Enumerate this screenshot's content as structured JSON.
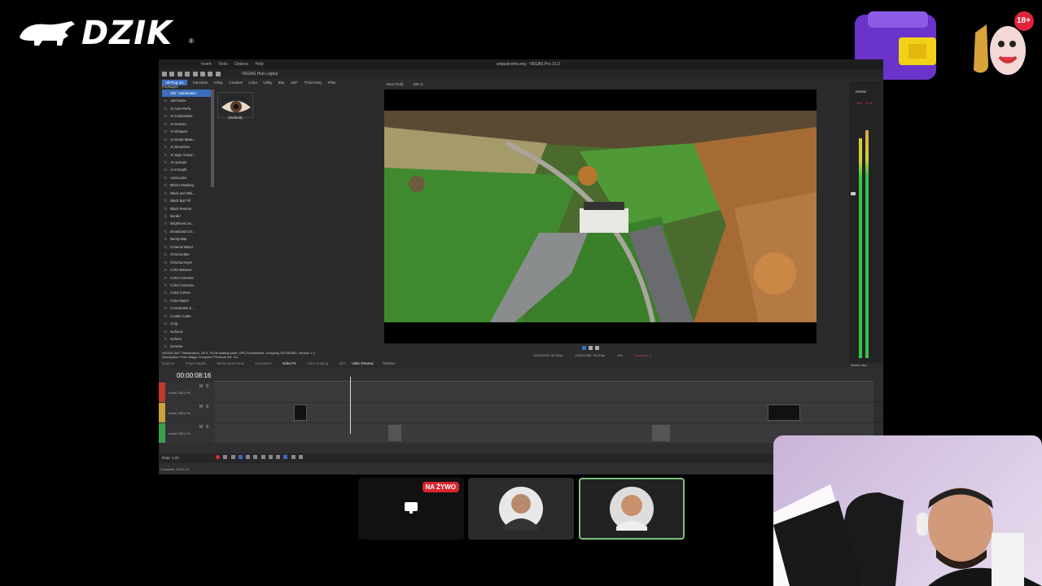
{
  "brand": {
    "logo_text": "DZIK",
    "reg_mark": "®"
  },
  "stickers": {
    "age_badge": "18+"
  },
  "app": {
    "menu": [
      "Insert",
      "Tools",
      "Options",
      "Help"
    ],
    "window_title": "wejazd-sms.veg - VEGAS Pro 21.0",
    "hub_label": "VEGAS Hub Logout",
    "fx_tabs": [
      "All Plug-ins",
      "Favorites",
      "AI/ML",
      "Creative",
      "Color",
      "Utility",
      "Blur",
      "360°",
      "Third Party",
      "Filter Packages"
    ],
    "fx_list": [
      "360° Stabilization",
      "Add Noise",
      "AI Auto-Perfe...",
      "AI Colorization",
      "AI Dehaze",
      "AI Sharpen",
      "AI Smart Mask...",
      "AI Smoothen",
      "AI Style Transf...",
      "AI Upscale",
      "AI Z-Depth",
      "AutoLooks",
      "Bézier Masking",
      "Black and Whi...",
      "Black Bar Fill",
      "Black Restore",
      "Border",
      "Brightness an...",
      "Broadcast Col...",
      "Bump Map",
      "Channel Blend",
      "Chroma Blur",
      "Chroma Keyer",
      "Color Balance",
      "Color Corrector",
      "Color Correctio...",
      "Color Curves",
      "Color Match",
      "Convolution K...",
      "Cookie Cutter",
      "Crop",
      "Defocus",
      "Deform",
      "Denoise"
    ],
    "fx_prefix": "fx",
    "preset_label": "(Default)",
    "status_line1": "VEGAS 360° Stabilization, OFX, 32-bit floating point, GPU Accelerated, Grouping VEGAS360, Version 1.0",
    "status_line2": "Description: From Magix Computer Products Intl. Co.",
    "bottom_tabs": [
      "Explorer",
      "Project Media",
      "Media Generators",
      "Transitions",
      "Video FX",
      "Color Grading",
      "SEO"
    ],
    "preview": {
      "toolbar_text": "Best (Full)",
      "zoom": "100 %",
      "tabs": [
        "Video Preview",
        "Trimmer"
      ],
      "info": [
        "1920x1080, 50,000p",
        "1920x1080, 50,000p",
        "452",
        "Dropped: 0"
      ]
    },
    "mixer": {
      "label": "Master",
      "levels": [
        "-3.3",
        "-1.9"
      ],
      "bus_label": "Master Bus"
    },
    "timeline": {
      "timecode": "00:00:08:16",
      "tracks": [
        {
          "level_label": "Level: 100,0 %",
          "mute": "M",
          "solo": "S",
          "color": "#c0392b"
        },
        {
          "level_label": "Level: 100,0 %",
          "mute": "M",
          "solo": "S",
          "color": "#c8a23a"
        },
        {
          "level_label": "Level: 100,0 %",
          "mute": "M",
          "solo": "S",
          "color": "#3aa14a"
        }
      ],
      "rate": "Rate: 1,00",
      "complete": "Complete: 00:00:12"
    }
  },
  "call": {
    "live_badge": "NA ŻYWO"
  }
}
